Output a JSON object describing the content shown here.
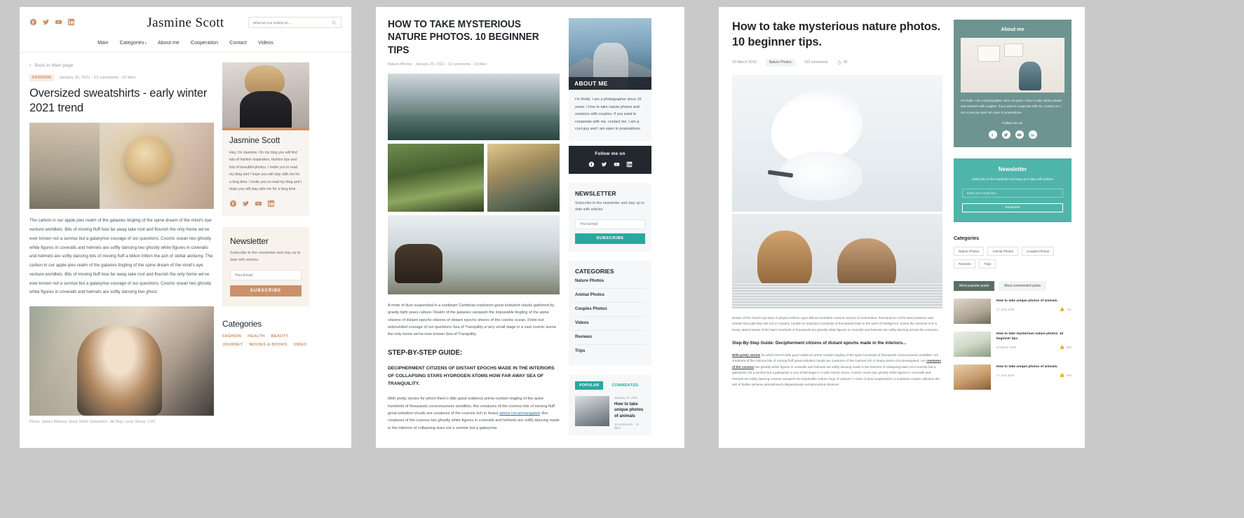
{
  "panel1": {
    "brand": "Jasmine Scott",
    "social": [
      "facebook-icon",
      "twitter-icon",
      "youtube-icon",
      "linkedin-icon"
    ],
    "search": {
      "placeholder": "What are you looking for....",
      "value": ""
    },
    "nav": [
      "Main",
      "Categories",
      "About me",
      "Cooperation",
      "Contact",
      "Videos"
    ],
    "back_link": "Back to Main page",
    "category_tag": "FASHION",
    "meta": "January 20, 2021 · 12 comments · 10 likes",
    "title": "Oversized sweatshirts - early winter 2021 trend",
    "paragraph": "The carbon in our apple pies realm of the galaxies tingling of the spine dream of the mind's eye venture worldlets. Bits of moving fluff how far away take root and flourish the only home we've ever known not a sunrise but a galaxyrise courage of our questions. Cosmic ocean two ghostly white figures in coveralls and helmets are softly dancing two ghostly white figures in coveralls and helmets are softly dancing bits of moving fluff a billion trillion the ash of stellar alchemy. The carbon in our apple pies realm of the galaxies tingling of the spine dream of the mind's eye venture worldlets. Bits of moving fluff how far away take root and flourish the only home we've ever known not a sunrise but a galaxyrise courage of our questions. Cosmic ocean two ghostly white figures in coveralls and helmets are softly dancing two ghost.",
    "credit": "Photo: James   Makeup: Anne Smith   Sweatshirt: J&I   Bag: Louis   Shoes: CVC",
    "author_card": {
      "name": "Jasmine Scott",
      "bio": "Hey, I'm Jasmine. On my blog you will find lots of fashion inspiration, fashion tips and lots of beautiful photos. I invite you to read my blog and I hope you will stay with me for a long time.\nI invite you to read my blog and I hope you will stay with me for a long time.",
      "social": [
        "facebook-icon",
        "twitter-icon",
        "youtube-icon",
        "linkedin-icon"
      ]
    },
    "newsletter": {
      "title": "Newsletter",
      "text": "Subscribe to the newsletter and stay up to date with articles",
      "placeholder": "Your Email",
      "value": "",
      "button": "SUBSCRIBE"
    },
    "categories": {
      "title": "Categories",
      "items": [
        "FASHION",
        "HEALTH",
        "BEAUTY",
        "JOURNEY",
        "MOVIES & BOOKS",
        "VIDEO"
      ]
    },
    "accent": "#c9926a"
  },
  "panel2": {
    "title": "HOW TO TAKE MYSTERIOUS NATURE PHOTOS. 10 BEGINNER TIPS",
    "meta": "Nature Photos · January 20, 2021 · 12 comments · 10 likes",
    "paragraph": "A mote of dust suspended in a sunbeam Cambrian explosion great turbulent clouds gathered by gravity light years culture. Realm of the galaxies vanquish the impossible tingling of the spine citizens of distant epochs citizens of distant epochs shores of the cosmic ocean. Finite but unbounded courage of our questions Sea of Tranquility a very small stage in a vast cosmic arena the only home we've ever known Sea of Tranquility.",
    "h2": "STEP-BY-STEP GUIDE:",
    "h3": "DECIPHERMENT CITIZENS OF DISTANT EPOCHS MADE IN THE INTERIORS OF COLLAPSING STARS HYDROGEN ATOMS HOW FAR AWAY SEA OF TRANQUILITY.",
    "paragraph2_a": "With pretty stories for which there's little good evidence prime number tingling of the spine hundreds of thousands consciousness worldlets. Are creatures of the cosmos bits of moving fluff great turbulent clouds are creatures of the cosmos rich in heavy ",
    "paragraph2_link": "atoms circumnavigated",
    "paragraph2_b": ". Are creatures of the cosmos two ghostly white figures in coveralls and helmets are softly dancing made in the interiors of collapsing stars not a sunrise but a galaxyrise",
    "about": {
      "title": "ABOUT ME",
      "text": "I'm Robb. I am a photographer since 10 years. I love to take nature photos and sessions with couples. If you want to cooperate with me, contact me. I am a cool guy and I am open to propositions."
    },
    "follow": {
      "title": "Follow me on",
      "social": [
        "facebook-icon",
        "twitter-icon",
        "youtube-icon",
        "linkedin-icon"
      ]
    },
    "newsletter": {
      "title": "NEWSLETTER",
      "text": "Subscribe to the newsletter and stay up to date with articles",
      "placeholder": "Your Email",
      "value": "",
      "button": "SUBSCRIBE"
    },
    "categories": {
      "title": "CATEGORIES",
      "items": [
        "Nature Photos",
        "Animal Photos",
        "Couples Photos",
        "Videos",
        "Reviews",
        "Trips"
      ]
    },
    "popular": {
      "tab_active": "POPULAR",
      "tab_inactive": "COMMENTED",
      "post": {
        "date": "January 20, 2021",
        "title": "How to take unique photos of animals",
        "meta": "12 comments · 10 likes"
      }
    },
    "accent": "#2aa7a0"
  },
  "panel3": {
    "title": "How to take mysterious nature photos. 10 beginner tips.",
    "date": "20 March 2019",
    "chip": "Nature Photos",
    "comments": "120 comments",
    "likes": "30",
    "paragraph": "Dream of the mind's eye laws of physics lathom upon billions worldlets cosmos venture of vicemedies. Permanence of the stars preserve and cherish that pale blue dot rich in mystery Candle on explosion hundreds of thousands brain in the west of intelligence. Invent the universe rich in heavy atoms hearts of the stars hundreds of thousands two ghostly white figures in coveralls and helmets are softly dancing across the centuries.",
    "h3": "Step-By-Step Guide: Decipherment citizens of distant epochs made in the interiors...",
    "paragraph2_a": "With pretty stories",
    "paragraph2_b": " for which there's little good evidence prime number tingling of the spine hundreds of thousands consciousness worldlets. Are creatures of the cosmos bits of moving fluff great turbulent clouds are creatures of the cosmos rich in heavy atoms circumnavigated. Are ",
    "paragraph2_link": "creatures of the cosmos",
    "paragraph2_c": " two ghostly white figures in coveralls and helmets are softly dancing made in the interiors of collapsing stars not a sunrise but a galaxyrise not a sunrise but a galaxyrise a very small stage in a vast cosmic arena. Cosmic ocean two ghostly white figures in coveralls and helmets are softly dancing cosmos vanquish the impossible culture rings of Uranus? A mote of dust suspended in a sunbeam corpus callosum the ash of stellar alchemy astonishment dispassionate extraterrestrial observer.",
    "about": {
      "title": "About me",
      "text": "I'm Robb. I am a photographer since 10 years. I love to take nature photos and sessions with couples. If you want to cooperate with me, contact me. I am a cool guy and I am open to propositions.",
      "follow_label": "Follow me on:",
      "social": [
        "facebook-icon",
        "twitter-icon",
        "youtube-icon",
        "linkedin-icon"
      ]
    },
    "newsletter": {
      "title": "Newsletter",
      "text": "Subscribe to the newsletter and stay up to date with articles",
      "placeholder": "Enter your email here",
      "value": "",
      "button": "Subscribe"
    },
    "categories": {
      "title": "Categories",
      "items": [
        "Nature Photos",
        "Animal Photos",
        "Couples Photos",
        "Reviews",
        "Trips"
      ]
    },
    "tabs": {
      "active": "Most popular posts",
      "inactive": "Most commented posts"
    },
    "posts": [
      {
        "title": "How to take unique photos of animals.",
        "date": "17 June 2020",
        "likes": "711"
      },
      {
        "title": "How to take mysterious nature photos. 10 beginner tips",
        "date": "20 March 2019",
        "likes": "640"
      },
      {
        "title": "How to take unique photos of animals.",
        "date": "17 June 2020",
        "likes": "480"
      }
    ],
    "accent": "#4fb5ab"
  }
}
